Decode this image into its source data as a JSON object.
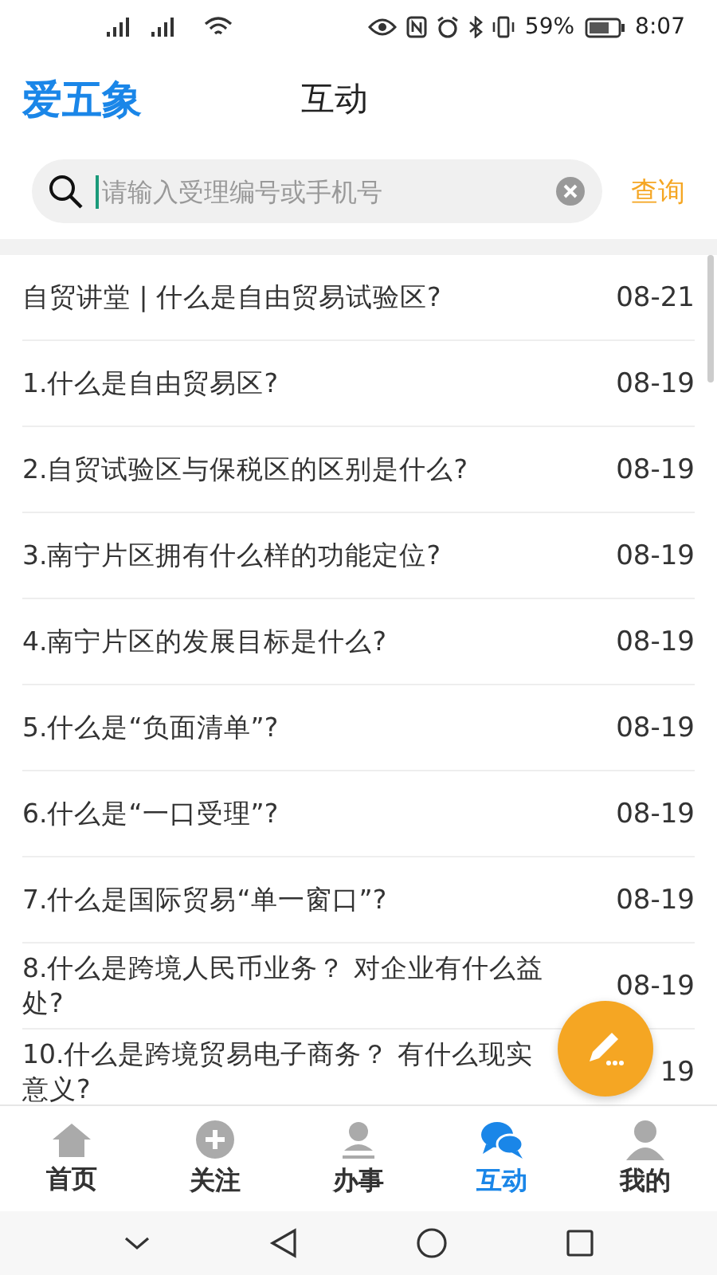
{
  "status_bar": {
    "battery": "59%",
    "time": "8:07"
  },
  "header": {
    "logo": "爱五象",
    "title": "互动"
  },
  "search": {
    "placeholder": "请输入受理编号或手机号",
    "button": "查询"
  },
  "rows": [
    {
      "title": "自贸讲堂 | 什么是自由贸易试验区?",
      "date": "08-21"
    },
    {
      "title": "1.什么是自由贸易区?",
      "date": "08-19"
    },
    {
      "title": "2.自贸试验区与保税区的区别是什么?",
      "date": "08-19"
    },
    {
      "title": "3.南宁片区拥有什么样的功能定位?",
      "date": "08-19"
    },
    {
      "title": "4.南宁片区的发展目标是什么?",
      "date": "08-19"
    },
    {
      "title": "5.什么是“负面清单”?",
      "date": "08-19"
    },
    {
      "title": "6.什么是“一口受理”?",
      "date": "08-19"
    },
    {
      "title": "7.什么是国际贸易“单一窗口”?",
      "date": "08-19"
    },
    {
      "title": "8.什么是跨境人民币业务？ 对企业有什么益处?",
      "date": "08-19"
    },
    {
      "title": "10.什么是跨境贸易电子商务？ 有什么现实意义?",
      "date": "19"
    }
  ],
  "tabs": [
    {
      "kind": "home",
      "label": "首页",
      "selected": false
    },
    {
      "kind": "plus",
      "label": "关注",
      "selected": false
    },
    {
      "kind": "person",
      "label": "办事",
      "selected": false
    },
    {
      "kind": "chat",
      "label": "互动",
      "selected": true
    },
    {
      "kind": "user",
      "label": "我的",
      "selected": false
    }
  ]
}
